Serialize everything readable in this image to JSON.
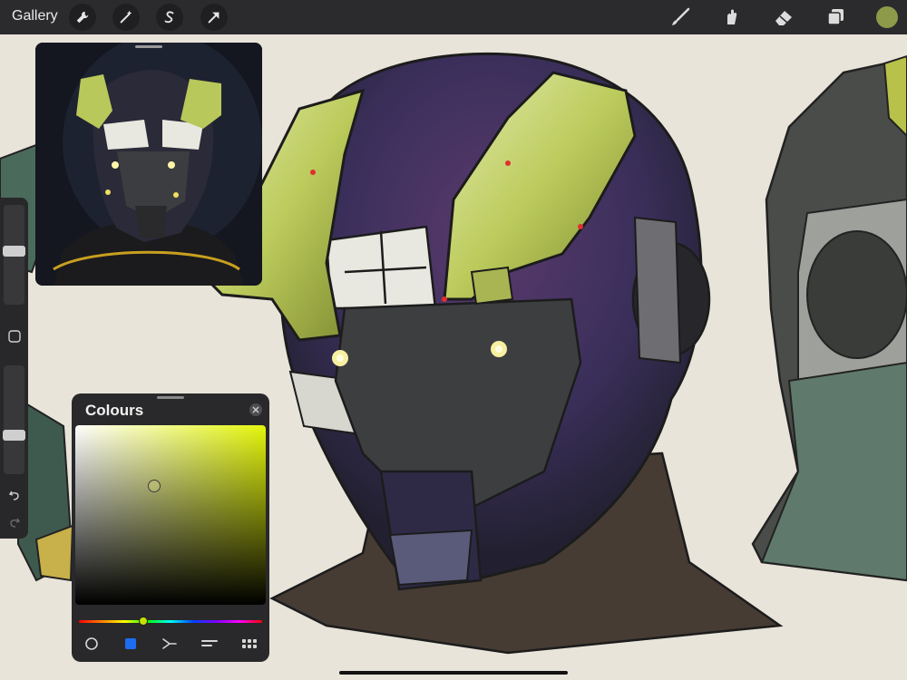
{
  "app": {
    "gallery_label": "Gallery",
    "current_colour": "#8c9a4a"
  },
  "toolbar": {
    "left_tools": [
      "wrench-icon",
      "magic-wand-icon",
      "selection-icon",
      "transform-arrow-icon"
    ],
    "right_tools": [
      "brush-icon",
      "smudge-icon",
      "eraser-icon",
      "layers-icon"
    ]
  },
  "colours_panel": {
    "title": "Colours",
    "hue_color": "#e4f50b",
    "modes": [
      "disc-mode-icon",
      "classic-mode-icon",
      "harmony-mode-icon",
      "value-mode-icon",
      "palettes-mode-icon"
    ]
  },
  "sidebar": {
    "tools": [
      "brush-size-slider",
      "modify-button",
      "opacity-slider",
      "undo-icon",
      "redo-icon"
    ]
  }
}
